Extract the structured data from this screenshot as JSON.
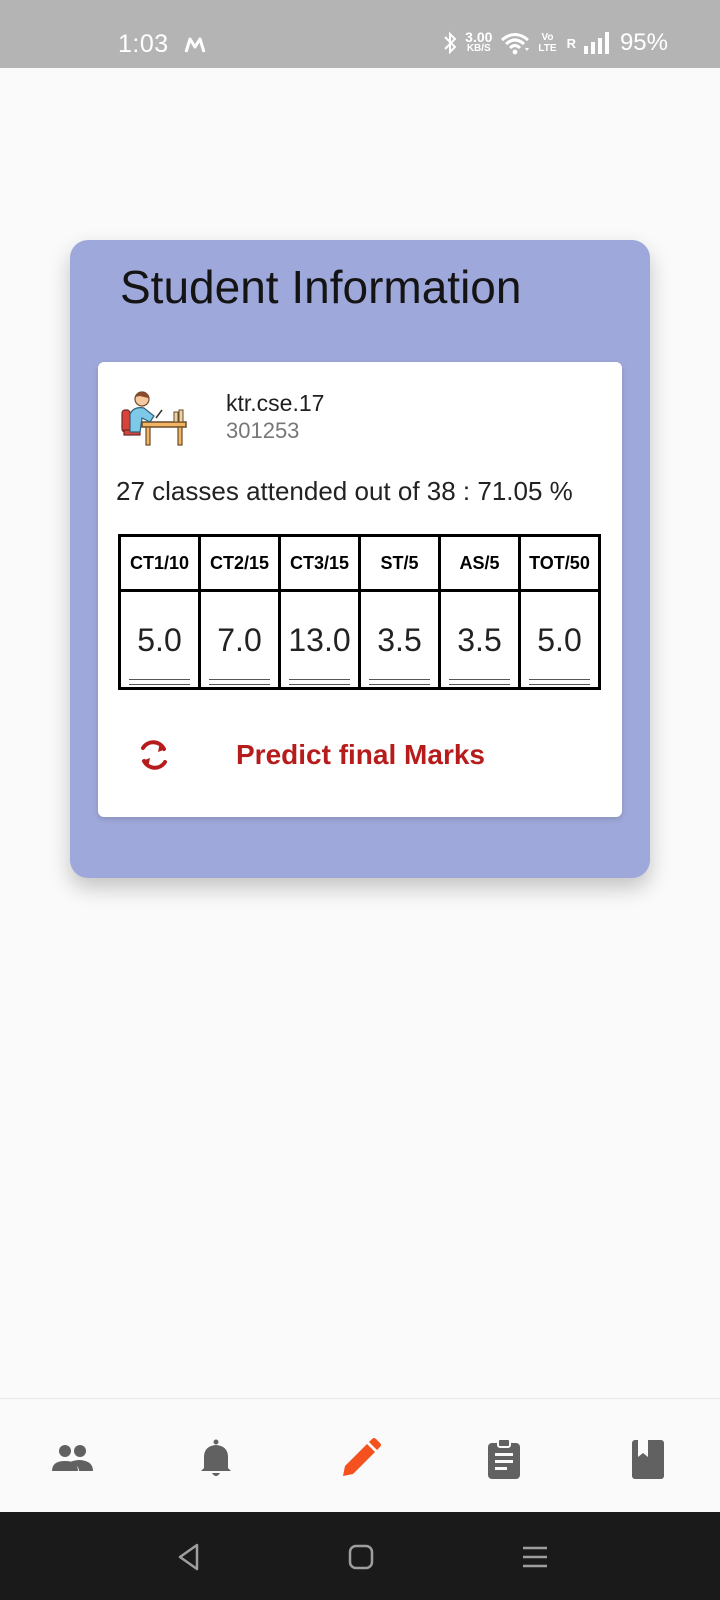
{
  "status_bar": {
    "time": "1:03",
    "net_speed_value": "3.00",
    "net_speed_unit": "KB/S",
    "volte_top": "Vo",
    "volte_bottom": "LTE",
    "roaming": "R",
    "battery": "95%"
  },
  "card": {
    "title": "Student Information"
  },
  "student": {
    "username": "ktr.cse.17",
    "id": "301253",
    "attendance": "27 classes attended out of 38 : 71.05 %"
  },
  "marks": {
    "headers": [
      "CT1/10",
      "CT2/15",
      "CT3/15",
      "ST/5",
      "AS/5",
      "TOT/50"
    ],
    "values": [
      "5.0",
      "7.0",
      "13.0",
      "3.5",
      "3.5",
      "5.0"
    ]
  },
  "predict": {
    "label": "Predict final Marks"
  },
  "colors": {
    "status_bar_bg": "#b4b4b4",
    "outer_card": "#9fa8da",
    "predict_text": "#b71c1c",
    "nav_active": "#f4511e",
    "nav_inactive": "#616161",
    "system_nav_bg": "#1a1a1a"
  },
  "bottom_nav": {
    "items": [
      {
        "icon": "people-icon",
        "active": false
      },
      {
        "icon": "bell-icon",
        "active": false
      },
      {
        "icon": "pencil-icon",
        "active": true
      },
      {
        "icon": "clipboard-icon",
        "active": false
      },
      {
        "icon": "book-icon",
        "active": false
      }
    ]
  }
}
